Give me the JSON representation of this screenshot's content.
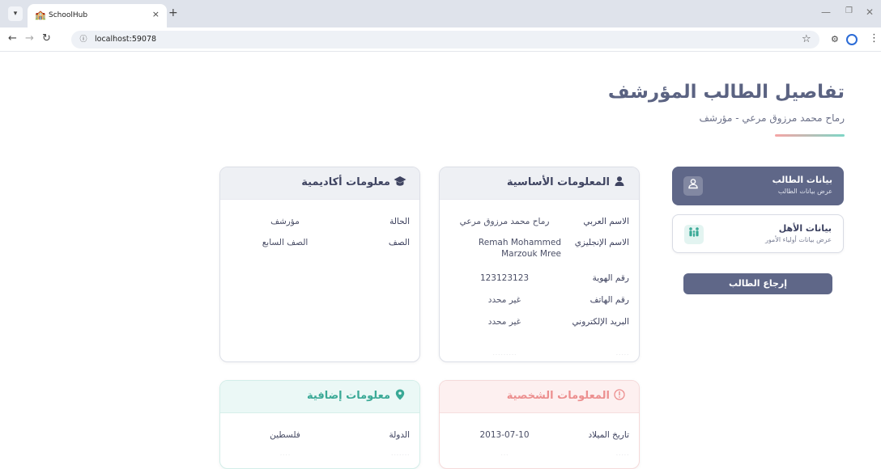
{
  "browser": {
    "tab_title": "SchoolHub",
    "tab_close": "×",
    "new_tab": "+",
    "url": "localhost:59078"
  },
  "icons": {
    "tab_menu": "chevron-down-icon",
    "favicon": "school-icon",
    "back": "back-arrow-icon",
    "forward": "forward-arrow-icon",
    "reload": "reload-icon",
    "info": "info-icon",
    "star": "star-icon",
    "extensions": "extensions-icon",
    "profile": "profile-icon",
    "menu": "kebab-menu-icon"
  },
  "page": {
    "title": "تفاصيل الطالب المؤرشف",
    "subtitle": "رماح محمد مرزوق مرعي - مؤرشف"
  },
  "nav": {
    "student": {
      "title": "بيانات الطالب",
      "subtitle": "عرض بيانات الطالب"
    },
    "parents": {
      "title": "بيانات الأهل",
      "subtitle": "عرض بيانات أولياء الأمور"
    },
    "restore_label": "إرجاع الطالب"
  },
  "basic_info": {
    "title": "المعلومات الأساسية",
    "rows": [
      {
        "label": "الاسم العربي",
        "value": "رماح محمد مرزوق مرعي"
      },
      {
        "label": "الاسم الإنجليزي",
        "value": "Remah Mohammed Marzouk Mree"
      },
      {
        "label": "رقم الهوية",
        "value": "123123123"
      },
      {
        "label": "رقم الهاتف",
        "value": "غير محدد"
      },
      {
        "label": "البريد الإلكتروني",
        "value": "غير محدد"
      }
    ]
  },
  "academic_info": {
    "title": "معلومات أكاديمية",
    "rows": [
      {
        "label": "الحالة",
        "value": "مؤرشف"
      },
      {
        "label": "الصف",
        "value": "الصف السابع"
      }
    ]
  },
  "personal_info": {
    "title": "المعلومات الشخصية",
    "rows": [
      {
        "label": "تاريخ الميلاد",
        "value": "2013-07-10"
      }
    ]
  },
  "extra_info": {
    "title": "معلومات إضافية",
    "rows": [
      {
        "label": "الدولة",
        "value": "فلسطين"
      }
    ]
  },
  "colors": {
    "primary": "#5f6788",
    "personal_accent": "#ec8f8f",
    "extra_accent": "#3aa996"
  }
}
